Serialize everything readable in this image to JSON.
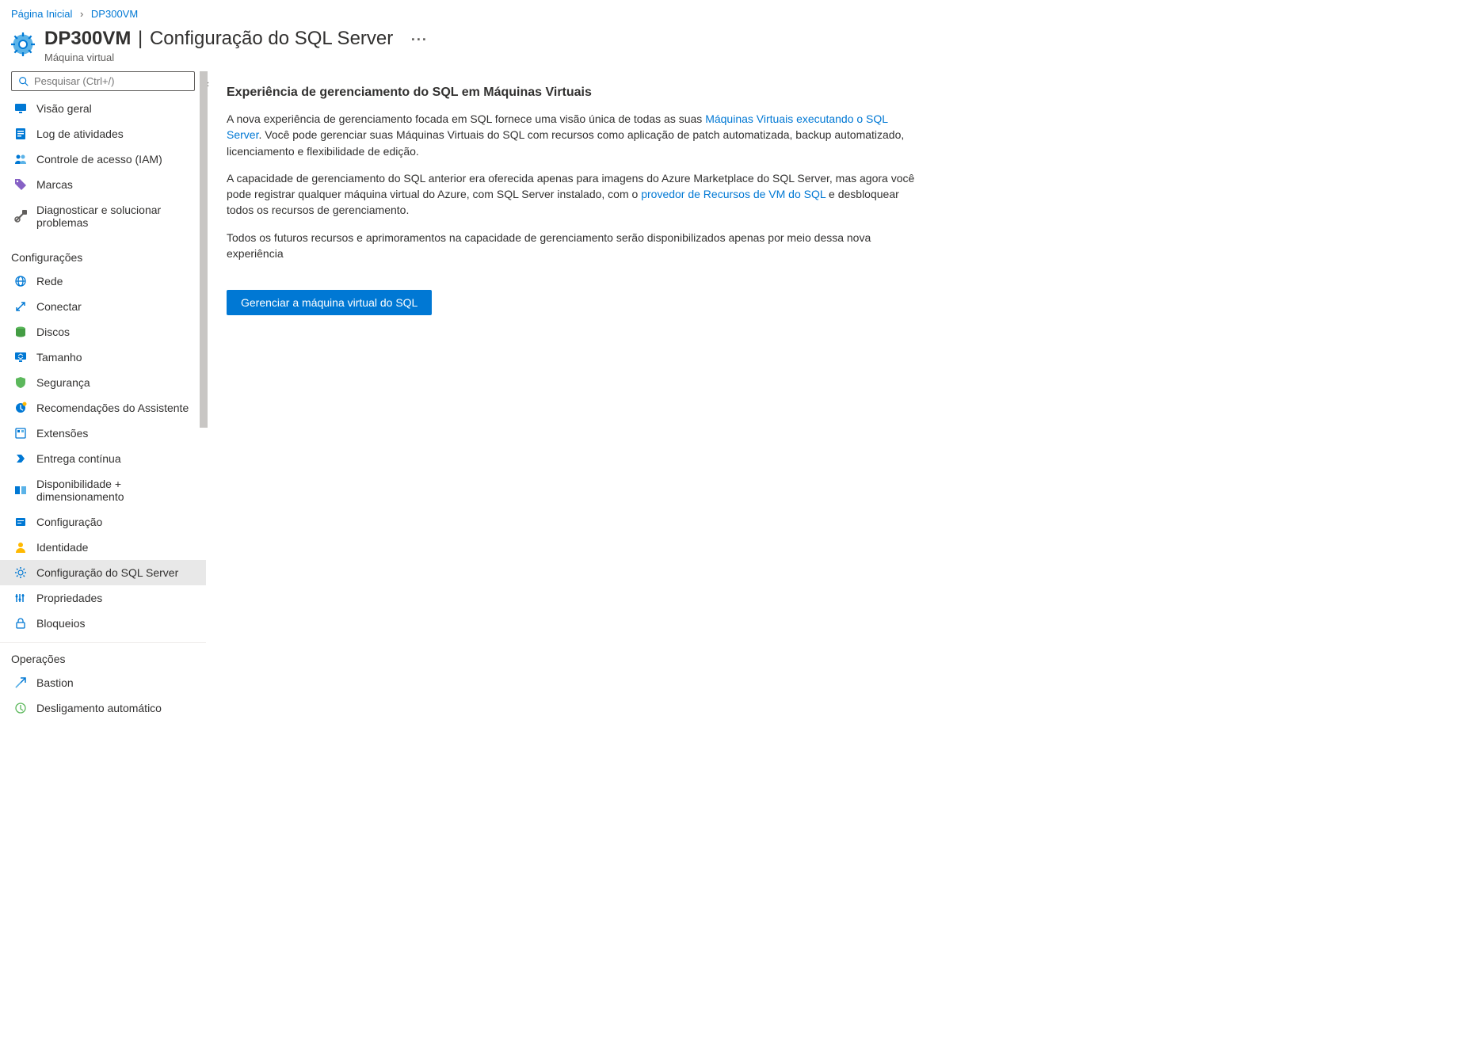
{
  "breadcrumb": {
    "home": "Página Inicial",
    "current": "DP300VM"
  },
  "header": {
    "title_main": "DP300VM",
    "title_section": "Configuração do SQL Server",
    "subtitle": "Máquina virtual"
  },
  "search": {
    "placeholder": "Pesquisar (Ctrl+/)"
  },
  "sidebar": {
    "top": [
      {
        "label": "Visão geral",
        "icon": "monitor"
      },
      {
        "label": "Log de atividades",
        "icon": "log"
      },
      {
        "label": "Controle de acesso (IAM)",
        "icon": "iam"
      },
      {
        "label": "Marcas",
        "icon": "tag"
      },
      {
        "label": "Diagnosticar e solucionar problemas",
        "icon": "diagnose"
      }
    ],
    "groups": [
      {
        "title": "Configurações",
        "items": [
          {
            "label": "Rede",
            "icon": "network"
          },
          {
            "label": "Conectar",
            "icon": "connect"
          },
          {
            "label": "Discos",
            "icon": "disks"
          },
          {
            "label": "Tamanho",
            "icon": "size"
          },
          {
            "label": "Segurança",
            "icon": "security"
          },
          {
            "label": "Recomendações do Assistente",
            "icon": "advisor"
          },
          {
            "label": "Extensões",
            "icon": "extensions"
          },
          {
            "label": "Entrega contínua",
            "icon": "cd"
          },
          {
            "label": "Disponibilidade + dimensionamento",
            "icon": "availability"
          },
          {
            "label": "Configuração",
            "icon": "config"
          },
          {
            "label": "Identidade",
            "icon": "identity"
          },
          {
            "label": "Configuração do SQL Server",
            "icon": "sqlconfig",
            "selected": true
          },
          {
            "label": "Propriedades",
            "icon": "properties"
          },
          {
            "label": "Bloqueios",
            "icon": "locks"
          }
        ]
      },
      {
        "title": "Operações",
        "items": [
          {
            "label": "Bastion",
            "icon": "bastion"
          },
          {
            "label": "Desligamento automático",
            "icon": "autoshutdown"
          }
        ]
      }
    ]
  },
  "content": {
    "heading": "Experiência de gerenciamento do SQL em Máquinas Virtuais",
    "p1_a": "A nova experiência de gerenciamento focada em SQL fornece uma visão única de todas as suas ",
    "p1_link": "Máquinas Virtuais executando o SQL Server",
    "p1_b": ". Você pode gerenciar suas Máquinas Virtuais do SQL com recursos como aplicação de patch automatizada, backup automatizado, licenciamento e flexibilidade de edição.",
    "p2_a": "A capacidade de gerenciamento do SQL anterior era oferecida apenas para imagens do Azure Marketplace do SQL Server, mas agora você pode registrar qualquer máquina virtual do Azure, com SQL Server instalado, com o ",
    "p2_link": "provedor de Recursos de VM do SQL",
    "p2_b": " e desbloquear todos os recursos de gerenciamento.",
    "p3": "Todos os futuros recursos e aprimoramentos na capacidade de gerenciamento serão disponibilizados apenas por meio dessa nova experiência",
    "button": "Gerenciar a máquina virtual do SQL"
  }
}
